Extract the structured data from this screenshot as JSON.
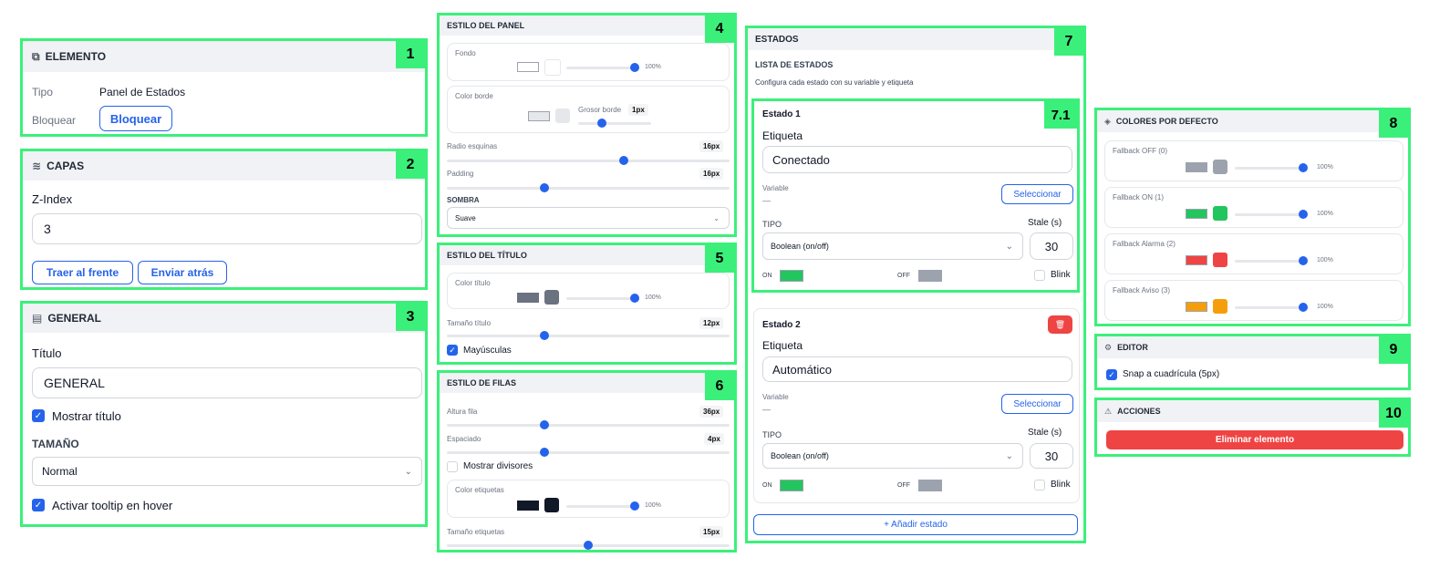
{
  "colors": {
    "highlight": "#3bf07a",
    "accent": "#2563eb",
    "danger": "#ef4444",
    "on_green": "#22c55e",
    "off_gray": "#9ca3af",
    "orange": "#f59e0b"
  },
  "elemento": {
    "badge": "1",
    "title": "ELEMENTO",
    "tipo_label": "Tipo",
    "tipo_value": "Panel de Estados",
    "bloquear_label": "Bloquear",
    "bloquear_button": "Bloquear"
  },
  "capas": {
    "badge": "2",
    "title": "CAPAS",
    "zindex_label": "Z-Index",
    "zindex_value": "3",
    "front_button": "Traer al frente",
    "back_button": "Enviar atrás"
  },
  "general": {
    "badge": "3",
    "title": "GENERAL",
    "titulo_label": "Título",
    "titulo_value": "GENERAL",
    "mostrar_titulo": "Mostrar título",
    "tamano_label": "TAMAÑO",
    "tamano_value": "Normal",
    "tooltip": "Activar tooltip en hover"
  },
  "estilo_panel": {
    "badge": "4",
    "title": "ESTILO DEL PANEL",
    "fondo": "Fondo",
    "fondo_opacity": "100%",
    "color_borde": "Color borde",
    "grosor_label": "Grosor borde",
    "grosor_value": "1px",
    "radio_label": "Radio esquinas",
    "radio_value": "16px",
    "padding_label": "Padding",
    "padding_value": "16px",
    "sombra_label": "SOMBRA",
    "sombra_value": "Suave",
    "radio_level": 0.63,
    "padding_level": 0.34,
    "grosor_level": 0.3,
    "fondo_level": 1.0
  },
  "estilo_titulo": {
    "badge": "5",
    "title": "ESTILO DEL TÍTULO",
    "color_titulo": "Color título",
    "color_opacity": "100%",
    "tamano_label": "Tamaño título",
    "tamano_value": "12px",
    "mayusculas": "Mayúsculas",
    "tamano_level": 0.34
  },
  "estilo_filas": {
    "badge": "6",
    "title": "ESTILO DE FILAS",
    "altura_label": "Altura fila",
    "altura_value": "36px",
    "espaciado_label": "Espaciado",
    "espaciado_value": "4px",
    "divisores": "Mostrar divisores",
    "color_etiquetas": "Color etiquetas",
    "color_opacity": "100%",
    "tamano_label": "Tamaño etiquetas",
    "tamano_value": "15px",
    "altura_level": 0.34,
    "espaciado_level": 0.34,
    "tamano_level": 0.5
  },
  "estados": {
    "badge": "7",
    "title": "ESTADOS",
    "lista": "LISTA DE ESTADOS",
    "desc": "Configura cada estado con su variable y etiqueta",
    "add_button": "+ Añadir estado",
    "items": [
      {
        "badge": "7.1",
        "name": "Estado 1",
        "etiqueta_label": "Etiqueta",
        "etiqueta_value": "Conectado",
        "variable_label": "Variable",
        "variable_value": "—",
        "select_button": "Seleccionar",
        "tipo_label": "TIPO",
        "tipo_value": "Boolean (on/off)",
        "stale_label": "Stale (s)",
        "stale_value": "30",
        "on_label": "ON",
        "off_label": "OFF",
        "blink": "Blink"
      },
      {
        "name": "Estado 2",
        "etiqueta_label": "Etiqueta",
        "etiqueta_value": "Automático",
        "variable_label": "Variable",
        "variable_value": "—",
        "select_button": "Seleccionar",
        "tipo_label": "TIPO",
        "tipo_value": "Boolean (on/off)",
        "stale_label": "Stale (s)",
        "stale_value": "30",
        "on_label": "ON",
        "off_label": "OFF",
        "blink": "Blink"
      }
    ]
  },
  "colores": {
    "badge": "8",
    "title": "COLORES POR DEFECTO",
    "items": [
      {
        "label": "Fallback OFF (0)",
        "opacity": "100%",
        "color": "#9ca3af"
      },
      {
        "label": "Fallback ON (1)",
        "opacity": "100%",
        "color": "#22c55e"
      },
      {
        "label": "Fallback Alarma (2)",
        "opacity": "100%",
        "color": "#ef4444"
      },
      {
        "label": "Fallback Aviso (3)",
        "opacity": "100%",
        "color": "#f59e0b"
      }
    ]
  },
  "editor": {
    "badge": "9",
    "title": "EDITOR",
    "snap": "Snap a cuadrícula (5px)"
  },
  "acciones": {
    "badge": "10",
    "title": "ACCIONES",
    "delete_button": "Eliminar elemento"
  }
}
